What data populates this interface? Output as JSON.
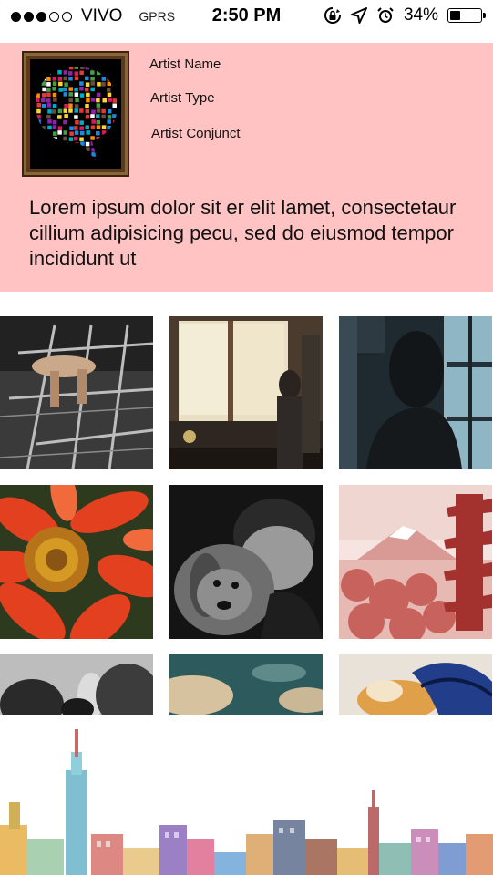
{
  "status_bar": {
    "signal_dots_on": 3,
    "signal_dots_total": 5,
    "carrier": "VIVO",
    "network": "GPRS",
    "time": "2:50 PM",
    "icons": [
      "rotation-lock-icon",
      "location-arrow-icon",
      "alarm-icon"
    ],
    "battery_percent_label": "34%",
    "battery_level": 0.34
  },
  "profile": {
    "background_color": "#ffc3c3",
    "avatar_icon": "speech-bubble-collage",
    "name_label": "Artist Name",
    "type_label": "Artist Type",
    "conjunct_label": "Artist Conjunct",
    "bio": "Lorem ipsum dolor sit er elit lamet, consectetaur cillium adipisicing pecu, sed do eiusmod tempor incididunt ut"
  },
  "gallery": {
    "photos": [
      "fire-escape-feet",
      "woman-at-window-kitchen",
      "woman-silhouette-window",
      "red-gerbera-flower",
      "man-with-dog-bw",
      "mount-fuji-pagoda-blossoms",
      "couple-bw",
      "sky-clouds",
      "cat-and-rope"
    ]
  },
  "footer": {
    "illustration": "watercolor-city-skyline"
  }
}
